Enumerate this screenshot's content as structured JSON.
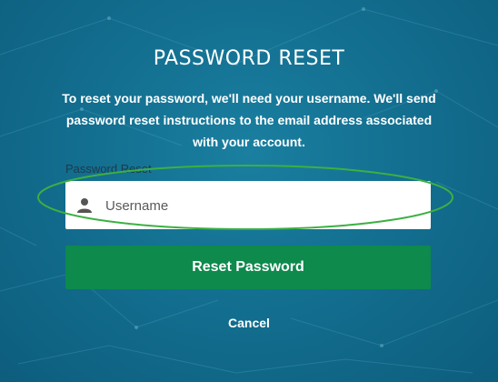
{
  "title": "PASSWORD RESET",
  "description": "To reset your password, we'll need your username. We'll send password reset instructions to the email address associated with your account.",
  "form": {
    "label": "Password Reset",
    "username_placeholder": "Username",
    "username_icon": "user-icon",
    "reset_button_label": "Reset Password",
    "cancel_label": "Cancel"
  },
  "colors": {
    "background": "#136f90",
    "button": "#0d8a4c",
    "highlight_outline": "#3cb043"
  }
}
